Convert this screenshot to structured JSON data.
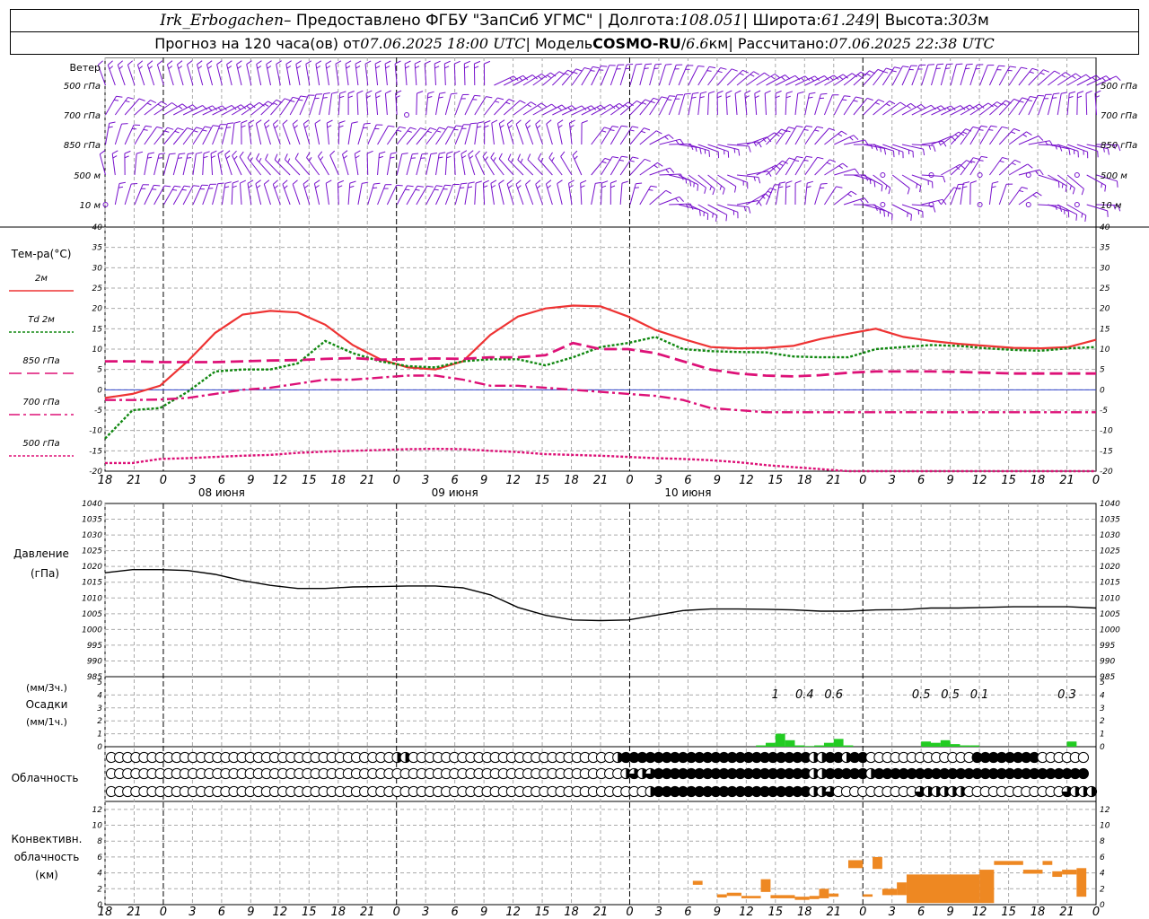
{
  "header": {
    "station": "Irk_Erbogachen",
    "provider": " – Предоставлено ФГБУ \"ЗапСиб УГМС\" | Долгота: ",
    "lon": "108.051",
    "lat_label": " | Широта: ",
    "lat": "61.249",
    "alt_label": " | Высота: ",
    "alt": "303",
    "alt_unit": "м",
    "forecast_label": "Прогноз на 120 часа(ов) от ",
    "forecast_time": "07.06.2025 18:00 UTC",
    "model_label": "  | Модель ",
    "model": "COSMO-RU",
    "model_sep": " / ",
    "model_res": "6.6",
    "model_res_unit": "км",
    "calc_label": " | Рассчитано: ",
    "calc_time": "07.06.2025 22:38 UTC"
  },
  "labels": {
    "wind": "Ветер",
    "wind_levels": [
      "500 гПа",
      "700 гПа",
      "850 гПа",
      "500 м",
      "10  м"
    ],
    "temp": "Тем-ра(°С)",
    "temp_legend": [
      "2м",
      "Td  2м",
      "850 гПа",
      "700 гПа",
      "500 гПа"
    ],
    "pressure": "Давление",
    "pressure_unit": "(гПа)",
    "precip_unit3": "(мм/3ч.)",
    "precip": "Осадки",
    "precip_unit1": "(мм/1ч.)",
    "cloud": "Облачность",
    "conv": [
      "Конвективн.",
      "облачность",
      "(км)"
    ]
  },
  "colors": {
    "t2m": "#ee3333",
    "td2m": "#118811",
    "t850": "#dd1177",
    "t700": "#dd1177",
    "t500": "#dd1177",
    "wind": "#7711cc",
    "precip": "#22cc22",
    "conv": "#ee8822",
    "grid": "#aaaaaa"
  },
  "chart_data": {
    "type": "line",
    "x_hours": [
      0,
      6,
      12,
      18,
      24,
      30,
      36,
      42,
      48,
      54,
      60,
      66,
      72,
      78,
      84,
      90,
      96,
      102,
      108,
      114,
      120
    ],
    "hour_labels": [
      "18",
      "21",
      "0",
      "3",
      "6",
      "9",
      "12",
      "15",
      "18",
      "21",
      "0",
      "3",
      "6",
      "9",
      "12",
      "15",
      "18",
      "21",
      "0",
      "3",
      "6",
      "9",
      "12",
      "15",
      "18",
      "21",
      "0",
      "3",
      "6",
      "9",
      "12",
      "15",
      "18",
      "21",
      "0",
      "3",
      "6",
      "9",
      "12",
      "15",
      "18",
      "21",
      "0"
    ],
    "day_labels": [
      "08 июня",
      "09 июня",
      "10 июня"
    ],
    "temperature": {
      "ylim": [
        -20,
        40
      ],
      "ticks": [
        -20,
        -15,
        -10,
        -5,
        0,
        5,
        10,
        15,
        20,
        25,
        30,
        35,
        40
      ],
      "series": [
        {
          "name": "2м",
          "values": [
            -2,
            -1,
            1,
            7,
            14,
            18.5,
            19.4,
            19,
            16,
            11,
            7.5,
            5.5,
            5,
            7,
            13.5,
            18,
            20,
            20.7,
            20.5,
            18,
            14.7,
            12.5,
            10.5,
            10.2,
            10.3,
            10.8,
            12.5,
            13.8,
            15,
            13,
            12,
            11.3,
            10.8,
            10.3,
            10.2,
            10.5,
            12.3
          ]
        },
        {
          "name": "Td  2м",
          "values": [
            -12,
            -5,
            -4.5,
            -0.5,
            4.5,
            5,
            5,
            6.5,
            12,
            9,
            7,
            5.8,
            5.5,
            7,
            7.5,
            7.5,
            6,
            8,
            10.5,
            11.5,
            13,
            10,
            9.5,
            9.3,
            9.2,
            8.2,
            8,
            8,
            10,
            10.5,
            11,
            10.8,
            10.2,
            9.8,
            9.6,
            10.2,
            10.5
          ]
        },
        {
          "name": "850 гПа",
          "values": [
            7,
            7,
            6.8,
            6.8,
            6.8,
            7,
            7.2,
            7.3,
            7.6,
            7.8,
            7.4,
            7.5,
            7.7,
            7.6,
            8,
            8,
            8.5,
            11.5,
            10,
            10,
            9,
            7,
            5,
            4,
            3.5,
            3.3,
            3.6,
            4.2,
            4.5,
            4.5,
            4.5,
            4.4,
            4.2,
            4,
            4,
            4,
            4
          ]
        },
        {
          "name": "700 гПа",
          "values": [
            -2.5,
            -2.5,
            -2.4,
            -2,
            -1,
            0,
            0.5,
            1.5,
            2.5,
            2.5,
            3,
            3.5,
            3.5,
            2.5,
            1,
            1,
            0.5,
            0,
            -0.5,
            -1,
            -1.5,
            -2.5,
            -4.5,
            -5,
            -5.5,
            -5.5,
            -5.5,
            -5.5,
            -5.5,
            -5.5,
            -5.5,
            -5.5,
            -5.5,
            -5.5,
            -5.5,
            -5.5,
            -5.5
          ]
        },
        {
          "name": "500 гПа",
          "values": [
            -18,
            -18,
            -17,
            -16.8,
            -16.5,
            -16.2,
            -16,
            -15.5,
            -15.2,
            -15,
            -14.8,
            -14.6,
            -14.5,
            -14.6,
            -15,
            -15.3,
            -15.8,
            -16,
            -16.2,
            -16.5,
            -16.8,
            -17,
            -17.3,
            -17.8,
            -18.5,
            -19,
            -19.5,
            -20,
            -20,
            -20,
            -20,
            -20,
            -20,
            -20,
            -20,
            -20,
            -20
          ]
        }
      ]
    },
    "pressure": {
      "ylim": [
        985,
        1040
      ],
      "ticks": [
        985,
        990,
        995,
        1000,
        1005,
        1010,
        1015,
        1020,
        1025,
        1030,
        1035,
        1040
      ],
      "values": [
        1018,
        1019,
        1019,
        1018.7,
        1017.5,
        1015.5,
        1014,
        1013,
        1013,
        1013.5,
        1013.6,
        1013.8,
        1013.8,
        1013.2,
        1011,
        1007,
        1004.5,
        1003,
        1002.8,
        1003,
        1004.5,
        1006,
        1006.5,
        1006.5,
        1006.4,
        1006.2,
        1005.8,
        1005.8,
        1006.2,
        1006.3,
        1006.8,
        1006.8,
        1007,
        1007.2,
        1007.2,
        1007.2,
        1006.8
      ]
    },
    "precip": {
      "ylim": [
        0,
        5
      ],
      "ticks": [
        0,
        1,
        2,
        3,
        4,
        5
      ],
      "totals": [
        {
          "hour": 69,
          "label": "1"
        },
        {
          "hour": 72,
          "label": "0.4"
        },
        {
          "hour": 75,
          "label": "0.6"
        },
        {
          "hour": 84,
          "label": "0.5"
        },
        {
          "hour": 87,
          "label": "0.5"
        },
        {
          "hour": 90,
          "label": "0.1"
        },
        {
          "hour": 99,
          "label": "0.3"
        }
      ],
      "hourly": [
        {
          "hour": 67.5,
          "value": 0.1
        },
        {
          "hour": 68.5,
          "value": 0.3
        },
        {
          "hour": 69.5,
          "value": 1.0
        },
        {
          "hour": 70.5,
          "value": 0.5
        },
        {
          "hour": 71.5,
          "value": 0.1
        },
        {
          "hour": 72.5,
          "value": 0.05
        },
        {
          "hour": 73.5,
          "value": 0.1
        },
        {
          "hour": 74.5,
          "value": 0.3
        },
        {
          "hour": 75.5,
          "value": 0.6
        },
        {
          "hour": 76.5,
          "value": 0.1
        },
        {
          "hour": 84.5,
          "value": 0.4
        },
        {
          "hour": 85.5,
          "value": 0.3
        },
        {
          "hour": 86.5,
          "value": 0.5
        },
        {
          "hour": 87.5,
          "value": 0.2
        },
        {
          "hour": 88.5,
          "value": 0.1
        },
        {
          "hour": 89.5,
          "value": 0.1
        },
        {
          "hour": 99.5,
          "value": 0.4
        }
      ]
    },
    "cloud_cover": {
      "rows": [
        "high",
        "mid",
        "low"
      ],
      "fraction_per_slot": {
        "high": [
          0,
          0,
          0,
          0,
          0,
          0,
          0,
          0,
          0,
          0,
          0,
          0,
          0,
          0,
          0,
          0,
          0,
          0,
          0,
          0,
          0,
          0,
          0,
          0,
          0,
          0,
          0,
          0,
          0,
          0,
          0,
          0,
          0,
          0,
          0,
          0.5,
          0.5,
          0,
          0,
          0,
          0,
          0,
          0,
          0,
          0,
          0,
          0,
          0,
          0,
          0,
          0,
          0,
          0,
          0,
          0,
          0,
          0,
          0,
          0,
          0,
          0,
          0,
          0.5,
          1,
          1,
          1,
          1,
          1,
          1,
          1,
          1,
          1,
          1,
          1,
          1,
          1,
          1,
          1,
          1,
          1,
          1,
          1,
          1,
          1,
          1,
          1,
          0.5,
          0.5,
          1,
          1,
          0.5,
          1,
          1,
          0,
          0,
          0,
          0,
          0,
          0,
          0,
          0,
          0,
          0,
          0,
          0,
          0,
          1,
          1,
          1,
          1,
          1,
          1,
          1,
          1,
          0,
          0,
          0,
          0,
          0,
          0
        ],
        "mid": [
          0,
          0,
          0,
          0,
          0,
          0,
          0,
          0,
          0,
          0,
          0,
          0,
          0,
          0,
          0,
          0,
          0,
          0,
          0,
          0,
          0,
          0,
          0,
          0,
          0,
          0,
          0,
          0,
          0,
          0,
          0,
          0,
          0,
          0,
          0,
          0,
          0,
          0,
          0,
          0,
          0,
          0,
          0,
          0,
          0,
          0,
          0,
          0,
          0,
          0,
          0,
          0,
          0,
          0,
          0,
          0,
          0,
          0,
          0,
          0,
          0,
          0,
          0,
          0.5,
          0.75,
          0.5,
          0.75,
          1,
          1,
          1,
          1,
          1,
          1,
          1,
          1,
          1,
          1,
          1,
          1,
          1,
          1,
          1,
          1,
          1,
          1,
          1,
          0.5,
          0.5,
          1,
          1,
          1,
          1,
          1,
          0.5,
          1,
          1,
          1,
          1,
          1,
          1,
          1,
          1,
          1,
          1,
          1,
          1,
          1,
          1,
          1,
          1,
          1,
          1,
          1,
          1,
          1,
          1,
          1,
          1,
          1,
          1
        ],
        "low": [
          0,
          0,
          0,
          0,
          0,
          0,
          0,
          0,
          0,
          0,
          0,
          0,
          0,
          0,
          0,
          0,
          0,
          0,
          0,
          0,
          0,
          0,
          0,
          0,
          0,
          0,
          0,
          0,
          0,
          0,
          0,
          0,
          0,
          0,
          0,
          0,
          0,
          0,
          0,
          0,
          0,
          0,
          0,
          0,
          0,
          0,
          0,
          0,
          0,
          0,
          0,
          0,
          0,
          0,
          0,
          0,
          0,
          0,
          0,
          0,
          0,
          0,
          0,
          0,
          0,
          0,
          0.5,
          1,
          1,
          1,
          1,
          1,
          1,
          1,
          1,
          1,
          1,
          1,
          1,
          1,
          1,
          1,
          1,
          1,
          1,
          1,
          0.5,
          0.5,
          0.75,
          0,
          0,
          0,
          0,
          0,
          0,
          0,
          0,
          0,
          0,
          0.75,
          0.5,
          0.5,
          0.5,
          0.5,
          0.5,
          0,
          0,
          0,
          0,
          0,
          0,
          0,
          0,
          0,
          0,
          0,
          0,
          0.75,
          0.5,
          0.5,
          0.5,
          0
        ]
      }
    },
    "convective_cloud": {
      "ylim": [
        0,
        13
      ],
      "ticks": [
        0,
        2,
        4,
        6,
        8,
        10,
        12
      ],
      "bars": [
        {
          "h0": 60.5,
          "h1": 61.5,
          "base": 2.5,
          "top": 3.0
        },
        {
          "h0": 63.0,
          "h1": 64.0,
          "base": 0.9,
          "top": 1.3
        },
        {
          "h0": 64.0,
          "h1": 65.5,
          "base": 1.1,
          "top": 1.5
        },
        {
          "h0": 65.5,
          "h1": 67.5,
          "base": 0.8,
          "top": 1.1
        },
        {
          "h0": 67.5,
          "h1": 68.5,
          "base": 1.6,
          "top": 3.2
        },
        {
          "h0": 68.5,
          "h1": 71.0,
          "base": 0.8,
          "top": 1.2
        },
        {
          "h0": 71.0,
          "h1": 72.5,
          "base": 0.6,
          "top": 1.0
        },
        {
          "h0": 72.5,
          "h1": 73.5,
          "base": 0.7,
          "top": 1.1
        },
        {
          "h0": 73.5,
          "h1": 74.5,
          "base": 0.8,
          "top": 2.0
        },
        {
          "h0": 74.5,
          "h1": 75.5,
          "base": 1.0,
          "top": 1.4
        },
        {
          "h0": 76.5,
          "h1": 78.0,
          "base": 4.6,
          "top": 5.6
        },
        {
          "h0": 78.0,
          "h1": 79.0,
          "base": 1.0,
          "top": 1.3
        },
        {
          "h0": 79.0,
          "h1": 80.0,
          "base": 4.5,
          "top": 6.0
        },
        {
          "h0": 80.0,
          "h1": 81.5,
          "base": 1.2,
          "top": 2.0
        },
        {
          "h0": 81.5,
          "h1": 82.5,
          "base": 1.2,
          "top": 2.8
        },
        {
          "h0": 82.5,
          "h1": 90.0,
          "base": 0.2,
          "top": 3.8
        },
        {
          "h0": 90.0,
          "h1": 91.5,
          "base": 0.2,
          "top": 4.4
        },
        {
          "h0": 91.5,
          "h1": 94.5,
          "base": 5.0,
          "top": 5.5
        },
        {
          "h0": 94.5,
          "h1": 96.5,
          "base": 3.9,
          "top": 4.4
        },
        {
          "h0": 96.5,
          "h1": 97.5,
          "base": 5.0,
          "top": 5.5
        },
        {
          "h0": 97.5,
          "h1": 98.5,
          "base": 3.5,
          "top": 4.2
        },
        {
          "h0": 98.5,
          "h1": 100.0,
          "base": 3.8,
          "top": 4.4
        },
        {
          "h0": 100.0,
          "h1": 101.0,
          "base": 1.0,
          "top": 4.6
        }
      ]
    },
    "wind": {
      "levels": [
        "500 гПа",
        "700 гПа",
        "850 гПа",
        "500 м",
        "10  м"
      ],
      "shown_as": "wind barbs every hour at each level"
    }
  }
}
